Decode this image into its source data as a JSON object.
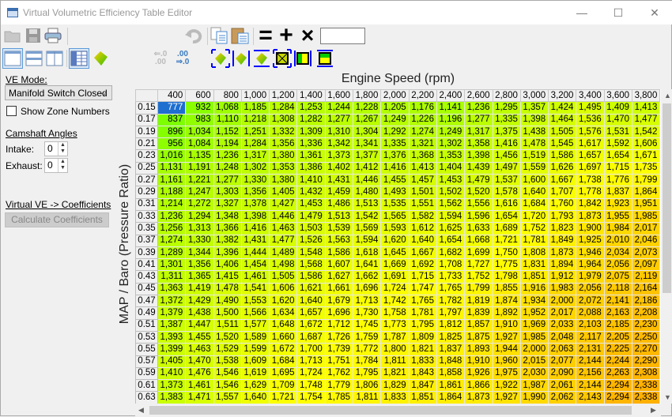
{
  "window": {
    "title": "Virtual Volumetric Efficiency Table Editor",
    "minimize": "—",
    "maximize": "☐",
    "close": "✕"
  },
  "toolbar": {
    "row1_icons": [
      "open-folder-icon",
      "save-icon",
      "print-icon",
      "undo-icon",
      "copy-icon",
      "paste-icon",
      "equals-icon",
      "plus-icon",
      "multiply-icon"
    ],
    "equals_label": "=",
    "plus_label": "+",
    "multiply_label": "×",
    "operand_value": "",
    "row2_icons": [
      "single-view-icon",
      "horizontal-split-icon",
      "vertical-split-icon",
      "table-view-icon",
      "fill-gradient-icon",
      "decrease-decimals-icon",
      "increase-decimals-icon",
      "smooth-all-icon",
      "smooth-horizontal-icon",
      "smooth-vertical-icon",
      "interpolate-icon",
      "interpolate-horizontal-icon",
      "interpolate-vertical-icon"
    ],
    "dec_label_top": "⇐.0",
    "dec_label_bot": ".00",
    "inc_label_top": ".00",
    "inc_label_bot": "⇒.0"
  },
  "left_panel": {
    "ve_mode_label": "VE Mode:",
    "ve_mode_value": "Manifold Switch Closed",
    "show_zone_numbers": "Show Zone Numbers",
    "show_zone_numbers_checked": false,
    "camshaft_label": "Camshaft Angles",
    "intake_label": "Intake:",
    "intake_value": "0",
    "exhaust_label": "Exhaust:",
    "exhaust_value": "0",
    "virtual_ve_label": "Virtual VE -> Coefficients",
    "calculate_button": "Calculate Coefficients"
  },
  "table": {
    "x_axis_label": "Engine Speed (rpm)",
    "y_axis_label": "MAP / Baro (Pressure Ratio)",
    "selected_cell": {
      "row": 0,
      "col": 0
    },
    "columns": [
      "400",
      "600",
      "800",
      "1,000",
      "1,200",
      "1,400",
      "1,600",
      "1,800",
      "2,000",
      "2,200",
      "2,400",
      "2,600",
      "2,800",
      "3,000",
      "3,200",
      "3,400",
      "3,600",
      "3,800"
    ],
    "rows": [
      {
        "map": "0.15",
        "values": [
          777,
          932,
          1068,
          1185,
          1284,
          1253,
          1244,
          1228,
          1205,
          1176,
          1141,
          1236,
          1295,
          1357,
          1424,
          1495,
          1409,
          1413
        ]
      },
      {
        "map": "0.17",
        "values": [
          837,
          983,
          1110,
          1218,
          1308,
          1282,
          1277,
          1267,
          1249,
          1226,
          1196,
          1277,
          1335,
          1398,
          1464,
          1536,
          1470,
          1477
        ]
      },
      {
        "map": "0.19",
        "values": [
          896,
          1034,
          1152,
          1251,
          1332,
          1309,
          1310,
          1304,
          1292,
          1274,
          1249,
          1317,
          1375,
          1438,
          1505,
          1576,
          1531,
          1542
        ]
      },
      {
        "map": "0.21",
        "values": [
          956,
          1084,
          1194,
          1284,
          1356,
          1336,
          1342,
          1341,
          1335,
          1321,
          1302,
          1358,
          1416,
          1478,
          1545,
          1617,
          1592,
          1606
        ]
      },
      {
        "map": "0.23",
        "values": [
          1016,
          1135,
          1236,
          1317,
          1380,
          1361,
          1373,
          1377,
          1376,
          1368,
          1353,
          1398,
          1456,
          1519,
          1586,
          1657,
          1654,
          1671
        ]
      },
      {
        "map": "0.25",
        "values": [
          1131,
          1191,
          1248,
          1302,
          1353,
          1386,
          1402,
          1412,
          1416,
          1413,
          1404,
          1439,
          1497,
          1559,
          1626,
          1697,
          1715,
          1735
        ]
      },
      {
        "map": "0.27",
        "values": [
          1161,
          1221,
          1277,
          1330,
          1380,
          1410,
          1431,
          1446,
          1455,
          1457,
          1453,
          1479,
          1537,
          1600,
          1667,
          1738,
          1776,
          1799
        ]
      },
      {
        "map": "0.29",
        "values": [
          1188,
          1247,
          1303,
          1356,
          1405,
          1432,
          1459,
          1480,
          1493,
          1501,
          1502,
          1520,
          1578,
          1640,
          1707,
          1778,
          1837,
          1864
        ]
      },
      {
        "map": "0.31",
        "values": [
          1214,
          1272,
          1327,
          1378,
          1427,
          1453,
          1486,
          1513,
          1535,
          1551,
          1562,
          1556,
          1616,
          1684,
          1760,
          1842,
          1923,
          1951
        ]
      },
      {
        "map": "0.33",
        "values": [
          1236,
          1294,
          1348,
          1398,
          1446,
          1479,
          1513,
          1542,
          1565,
          1582,
          1594,
          1596,
          1654,
          1720,
          1793,
          1873,
          1955,
          1985
        ]
      },
      {
        "map": "0.35",
        "values": [
          1256,
          1313,
          1366,
          1416,
          1463,
          1503,
          1539,
          1569,
          1593,
          1612,
          1625,
          1633,
          1689,
          1752,
          1823,
          1900,
          1984,
          2017
        ]
      },
      {
        "map": "0.37",
        "values": [
          1274,
          1330,
          1382,
          1431,
          1477,
          1526,
          1563,
          1594,
          1620,
          1640,
          1654,
          1668,
          1721,
          1781,
          1849,
          1925,
          2010,
          2046
        ]
      },
      {
        "map": "0.39",
        "values": [
          1289,
          1344,
          1396,
          1444,
          1489,
          1548,
          1586,
          1618,
          1645,
          1667,
          1682,
          1699,
          1750,
          1808,
          1873,
          1946,
          2034,
          2073
        ]
      },
      {
        "map": "0.41",
        "values": [
          1301,
          1356,
          1406,
          1454,
          1498,
          1568,
          1607,
          1641,
          1669,
          1692,
          1708,
          1727,
          1775,
          1831,
          1894,
          1964,
          2056,
          2097
        ]
      },
      {
        "map": "0.43",
        "values": [
          1311,
          1365,
          1415,
          1461,
          1505,
          1586,
          1627,
          1662,
          1691,
          1715,
          1733,
          1752,
          1798,
          1851,
          1912,
          1979,
          2075,
          2119
        ]
      },
      {
        "map": "0.45",
        "values": [
          1363,
          1419,
          1478,
          1541,
          1606,
          1621,
          1661,
          1696,
          1724,
          1747,
          1765,
          1799,
          1855,
          1916,
          1983,
          2056,
          2118,
          2164
        ]
      },
      {
        "map": "0.47",
        "values": [
          1372,
          1429,
          1490,
          1553,
          1620,
          1640,
          1679,
          1713,
          1742,
          1765,
          1782,
          1819,
          1874,
          1934,
          2000,
          2072,
          2141,
          2186
        ]
      },
      {
        "map": "0.49",
        "values": [
          1379,
          1438,
          1500,
          1566,
          1634,
          1657,
          1696,
          1730,
          1758,
          1781,
          1797,
          1839,
          1892,
          1952,
          2017,
          2088,
          2163,
          2208
        ]
      },
      {
        "map": "0.51",
        "values": [
          1387,
          1447,
          1511,
          1577,
          1648,
          1672,
          1712,
          1745,
          1773,
          1795,
          1812,
          1857,
          1910,
          1969,
          2033,
          2103,
          2185,
          2230
        ]
      },
      {
        "map": "0.53",
        "values": [
          1393,
          1455,
          1520,
          1589,
          1660,
          1687,
          1726,
          1759,
          1787,
          1809,
          1825,
          1875,
          1927,
          1985,
          2048,
          2117,
          2205,
          2250
        ]
      },
      {
        "map": "0.55",
        "values": [
          1399,
          1463,
          1529,
          1599,
          1672,
          1700,
          1739,
          1772,
          1800,
          1821,
          1837,
          1893,
          1944,
          2000,
          2063,
          2131,
          2225,
          2270
        ]
      },
      {
        "map": "0.57",
        "values": [
          1405,
          1470,
          1538,
          1609,
          1684,
          1713,
          1751,
          1784,
          1811,
          1833,
          1848,
          1910,
          1960,
          2015,
          2077,
          2144,
          2244,
          2290
        ]
      },
      {
        "map": "0.59",
        "values": [
          1410,
          1476,
          1546,
          1619,
          1695,
          1724,
          1762,
          1795,
          1821,
          1843,
          1858,
          1926,
          1975,
          2030,
          2090,
          2156,
          2263,
          2308
        ]
      },
      {
        "map": "0.61",
        "values": [
          1373,
          1461,
          1546,
          1629,
          1709,
          1748,
          1779,
          1806,
          1829,
          1847,
          1861,
          1866,
          1922,
          1987,
          2061,
          2144,
          2294,
          2338
        ]
      },
      {
        "map": "0.63",
        "values": [
          1383,
          1471,
          1557,
          1640,
          1721,
          1754,
          1785,
          1811,
          1833,
          1851,
          1864,
          1873,
          1927,
          1990,
          2062,
          2143,
          2294,
          2338
        ]
      }
    ]
  },
  "colors": {
    "selected": "#1e6fd0",
    "low": "#7cff00",
    "mid": "#ffff00",
    "high": "#ffb000"
  }
}
